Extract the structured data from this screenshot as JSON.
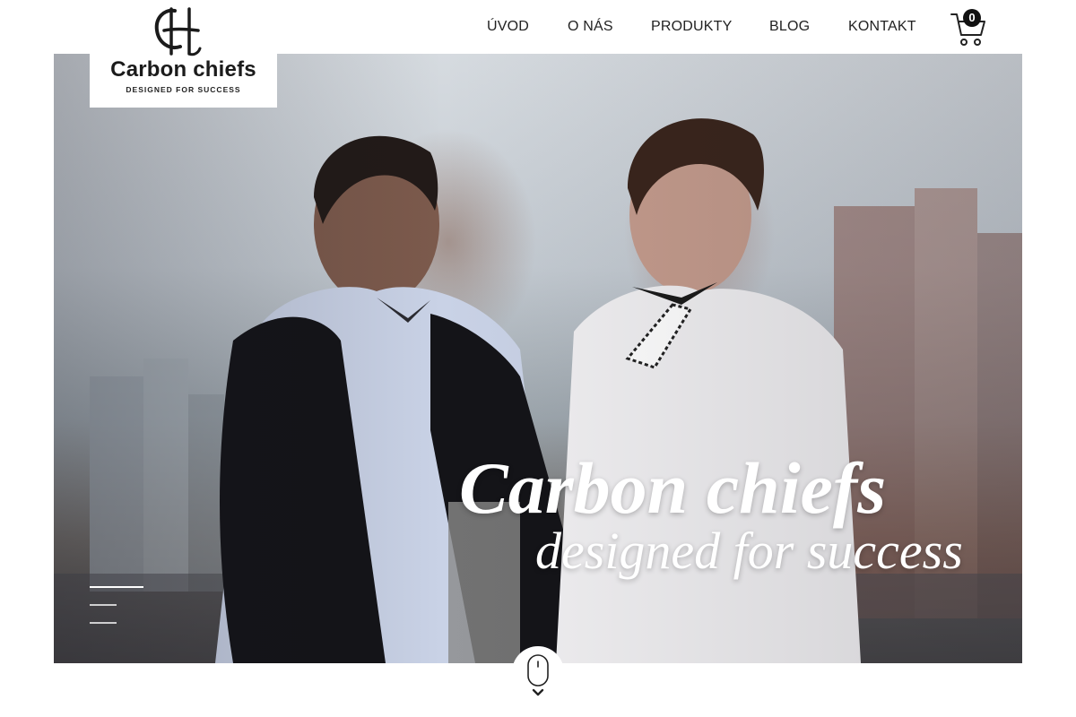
{
  "brand": {
    "name": "Carbon chiefs",
    "tagline": "DESIGNED FOR SUCCESS"
  },
  "nav": {
    "items": [
      {
        "label": "ÚVOD"
      },
      {
        "label": "O NÁS"
      },
      {
        "label": "PRODUKTY"
      },
      {
        "label": "BLOG"
      },
      {
        "label": "KONTAKT"
      }
    ]
  },
  "cart": {
    "count": "0",
    "icon": "shopping-cart-icon"
  },
  "hero": {
    "title": "Carbon chiefs",
    "subtitle": "designed for success",
    "image_desc_icon": "hero-photo"
  },
  "scroll": {
    "icon": "mouse-scroll-icon"
  },
  "colors": {
    "accent": "#111111",
    "header_bg": "#ffffff",
    "hero_text": "#ffffff"
  }
}
